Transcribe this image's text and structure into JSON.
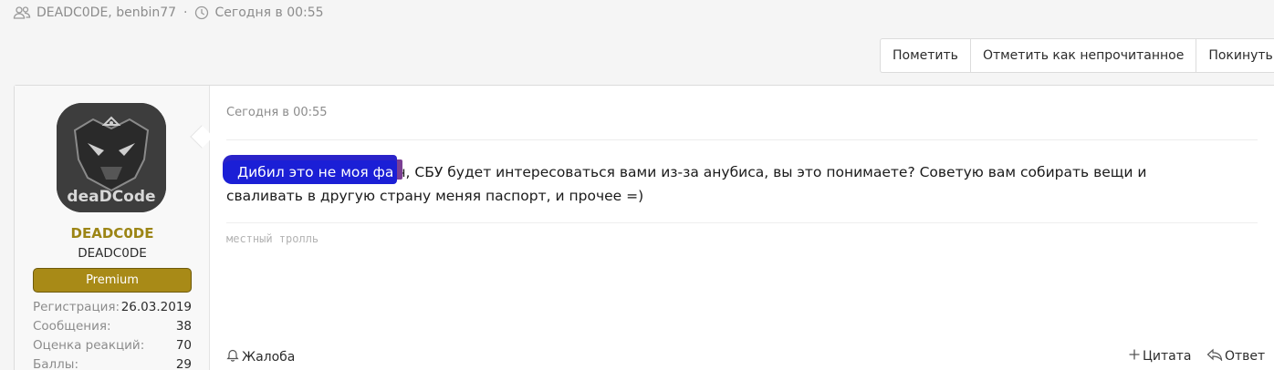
{
  "thread_meta": {
    "participants": "DEADC0DE, benbin77",
    "separator": "·",
    "time": "Сегодня в 00:55"
  },
  "actions": [
    {
      "label": "Пометить"
    },
    {
      "label": "Отметить как непрочитанное"
    },
    {
      "label": "Покинуть"
    }
  ],
  "post": {
    "date": "Сегодня в 00:55",
    "redacted_overlay": "Дибил это не моя фа",
    "text_after_redaction": "ч, СБУ будет интересоваться вами из-за анубиса, вы это понимаете? Советую вам собирать вещи и",
    "text_line2": "сваливать в другую страну меняя паспорт, и прочее =)",
    "signature": "местный тролль",
    "footer": {
      "report": "Жалоба",
      "quote": "Цитата",
      "reply": "Ответ"
    }
  },
  "user": {
    "avatar_text": "deaDCode",
    "name": "DEADC0DE",
    "title": "DEADC0DE",
    "badge": "Premium",
    "stats": [
      {
        "key": "Регистрация:",
        "value": "26.03.2019"
      },
      {
        "key": "Сообщения:",
        "value": "38"
      },
      {
        "key": "Оценка реакций:",
        "value": "70"
      },
      {
        "key": "Баллы:",
        "value": "29"
      }
    ]
  },
  "colors": {
    "username": "#9c8515",
    "badge_bg": "#a88a17",
    "redaction": "#1b1fd6"
  }
}
